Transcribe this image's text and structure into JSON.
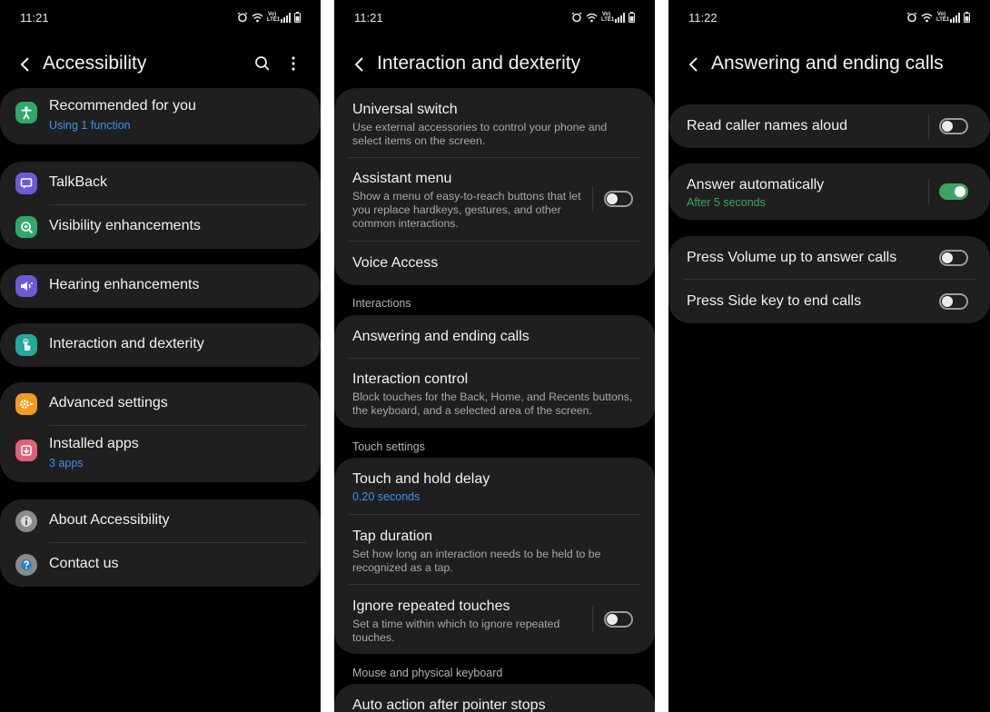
{
  "colors": {
    "card": "#1f1f1f",
    "accent_blue": "#3e91ee",
    "toggle_on": "#3ca562",
    "icon_green": "#2fa86a",
    "icon_purple": "#6a5bd6",
    "icon_teal": "#23a89b",
    "icon_orange": "#f29b1c",
    "icon_pink": "#e0607a",
    "icon_gray": "#8a8a8a"
  },
  "screen1": {
    "status_time": "11:21",
    "title": "Accessibility",
    "groups": [
      {
        "items": [
          {
            "label": "Recommended for you",
            "sub": "Using 1 function",
            "icon": "accessibility-person-icon"
          }
        ]
      },
      {
        "items": [
          {
            "label": "TalkBack",
            "icon": "talkback-icon"
          },
          {
            "label": "Visibility enhancements",
            "icon": "magnifier-icon"
          }
        ]
      },
      {
        "items": [
          {
            "label": "Hearing enhancements",
            "icon": "hearing-volume-icon"
          }
        ]
      },
      {
        "items": [
          {
            "label": "Interaction and dexterity",
            "icon": "touch-hand-icon"
          }
        ]
      },
      {
        "items": [
          {
            "label": "Advanced settings",
            "icon": "gear-dots-icon"
          },
          {
            "label": "Installed apps",
            "sub": "3 apps",
            "icon": "download-apps-icon"
          }
        ]
      },
      {
        "items": [
          {
            "label": "About Accessibility",
            "icon": "info-icon"
          },
          {
            "label": "Contact us",
            "icon": "question-icon"
          }
        ]
      }
    ]
  },
  "screen2": {
    "status_time": "11:21",
    "title": "Interaction and dexterity",
    "universal_switch": {
      "label": "Universal switch",
      "desc": "Use external accessories to control your phone and select items on the screen."
    },
    "assistant_menu": {
      "label": "Assistant menu",
      "desc": "Show a menu of easy-to-reach buttons that let you replace hardkeys, gestures, and other common interactions.",
      "enabled": false
    },
    "voice_access": {
      "label": "Voice Access"
    },
    "section_interactions": "Interactions",
    "answering_calls": {
      "label": "Answering and ending calls"
    },
    "interaction_control": {
      "label": "Interaction control",
      "desc": "Block touches for the Back, Home, and Recents buttons, the keyboard, and a selected area of the screen."
    },
    "section_touch": "Touch settings",
    "touch_hold": {
      "label": "Touch and hold delay",
      "sub": "0.20 seconds"
    },
    "tap_duration": {
      "label": "Tap duration",
      "desc": "Set how long an interaction needs to be held to be recognized as a tap."
    },
    "ignore_repeated": {
      "label": "Ignore repeated touches",
      "desc": "Set a time within which to ignore repeated touches.",
      "enabled": false
    },
    "section_mouse": "Mouse and physical keyboard",
    "auto_action": {
      "label": "Auto action after pointer stops"
    }
  },
  "screen3": {
    "status_time": "11:22",
    "title": "Answering and ending calls",
    "read_caller": {
      "label": "Read caller names aloud",
      "enabled": false
    },
    "answer_auto": {
      "label": "Answer automatically",
      "sub": "After 5 seconds",
      "enabled": true
    },
    "press_volume": {
      "label": "Press Volume up to answer calls",
      "enabled": false
    },
    "press_side": {
      "label": "Press Side key to end calls",
      "enabled": false
    }
  }
}
